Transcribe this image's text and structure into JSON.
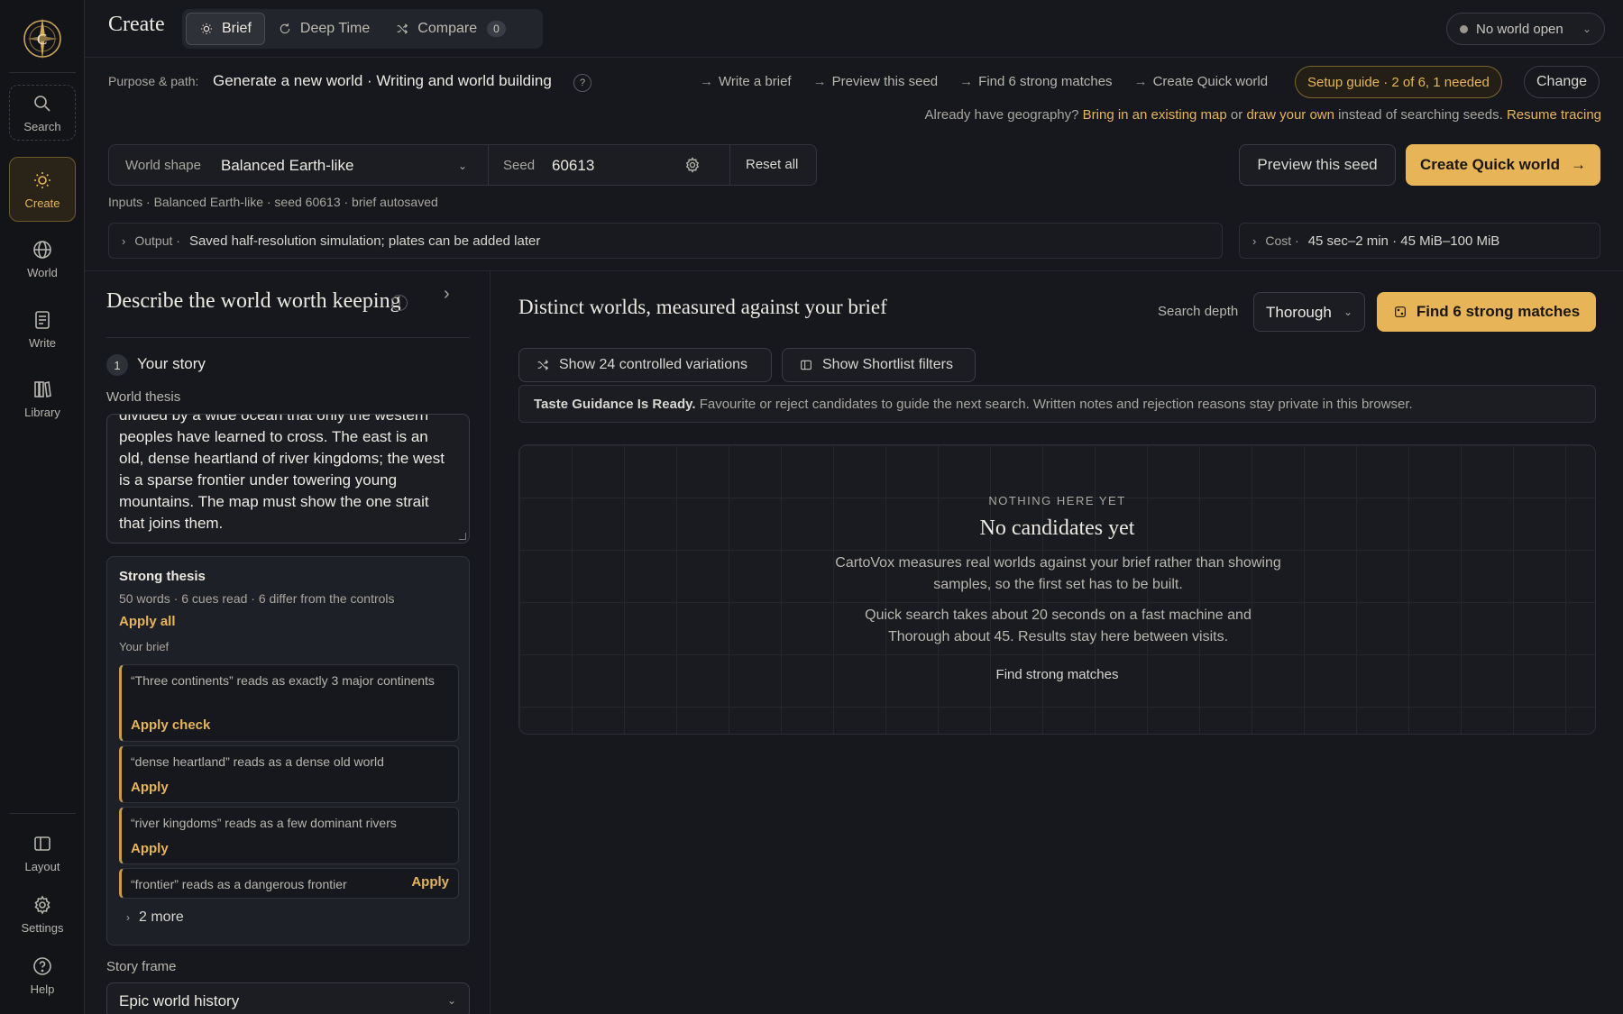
{
  "rail": {
    "items": [
      {
        "label": "Search",
        "icon": "search-icon"
      },
      {
        "label": "Create",
        "icon": "sun-icon"
      },
      {
        "label": "World",
        "icon": "globe-icon"
      },
      {
        "label": "Write",
        "icon": "document-icon"
      },
      {
        "label": "Library",
        "icon": "books-icon"
      }
    ],
    "bottom": [
      {
        "label": "Layout",
        "icon": "layout-icon"
      },
      {
        "label": "Settings",
        "icon": "gear-icon"
      },
      {
        "label": "Help",
        "icon": "help-icon"
      }
    ]
  },
  "header": {
    "title": "Create",
    "tabs": [
      {
        "label": "Brief",
        "icon": "sun-icon"
      },
      {
        "label": "Deep Time",
        "icon": "cycle-icon"
      },
      {
        "label": "Compare",
        "icon": "shuffle-icon",
        "count": "0"
      }
    ],
    "world_status": "No world open"
  },
  "purpose": {
    "label": "Purpose & path:",
    "value": "Generate a new world · Writing and world building",
    "help": "?",
    "steps": [
      "Write a brief",
      "Preview this seed",
      "Find 6 strong matches",
      "Create Quick world"
    ],
    "setup": "Setup guide · 2 of 6, 1 needed",
    "change": "Change",
    "geo_prefix": "Already have geography?",
    "geo_link1": "Bring in an existing map",
    "geo_or": "or",
    "geo_link2": "draw your own",
    "geo_mid": "instead of searching seeds.",
    "geo_link3": "Resume tracing"
  },
  "inputs": {
    "shape_label": "World shape",
    "shape_value": "Balanced Earth-like",
    "seed_label": "Seed",
    "seed_value": "60613",
    "reset": "Reset all",
    "preview": "Preview this seed",
    "create": "Create Quick world",
    "summary": "Inputs · Balanced Earth-like · seed 60613 · brief autosaved"
  },
  "output": {
    "label": "Output ·",
    "value": "Saved half-resolution simulation; plates can be added later"
  },
  "cost": {
    "label": "Cost ·",
    "value": "45 sec–2 min · 45 MiB–100 MiB"
  },
  "left": {
    "title": "Describe the world worth keeping",
    "info": "i",
    "step_num": "1",
    "step_title": "Your story",
    "thesis_label": "World thesis",
    "thesis_lines": [
      "divided by a wide ocean that only the western",
      "peoples have learned to cross. The east is an",
      "old, dense heartland of river kingdoms; the west",
      "is a sparse frontier under towering young",
      "mountains. The map must show the one strait",
      "that joins them."
    ],
    "card": {
      "title": "Strong thesis",
      "meta": "50 words · 6 cues read · 6 differ from the controls",
      "apply_all": "Apply all",
      "brief_label": "Your brief",
      "cues": [
        {
          "text": "“Three continents” reads as exactly 3 major continents",
          "action": "Apply check"
        },
        {
          "text": "“dense heartland” reads as a dense old world",
          "action": "Apply"
        },
        {
          "text": "“river kingdoms” reads as a few dominant rivers",
          "action": "Apply"
        },
        {
          "text": "“frontier” reads as a dangerous frontier",
          "action": "Apply"
        }
      ],
      "more": "2 more"
    },
    "story_label": "Story frame",
    "story_value": "Epic world history"
  },
  "right": {
    "title": "Distinct worlds, measured against your brief",
    "depth_label": "Search depth",
    "depth_value": "Thorough",
    "find": "Find 6 strong matches",
    "chip1": "Show 24 controlled variations",
    "chip2": "Show Shortlist filters",
    "taste_bold": "Taste Guidance Is Ready.",
    "taste_text": "Favourite or reject candidates to guide the next search. Written notes and rejection reasons stay private in this browser.",
    "empty_kicker": "NOTHING HERE YET",
    "empty_title": "No candidates yet",
    "empty_p1": "CartoVox measures real worlds against your brief rather than showing samples, so the first set has to be built.",
    "empty_p2": "Quick search takes about 20 seconds on a fast machine and Thorough about 45. Results stay here between visits.",
    "empty_link": "Find strong matches"
  },
  "colors": {
    "accent": "#e7b457",
    "background": "#16181d",
    "panel": "#1b1d22"
  }
}
